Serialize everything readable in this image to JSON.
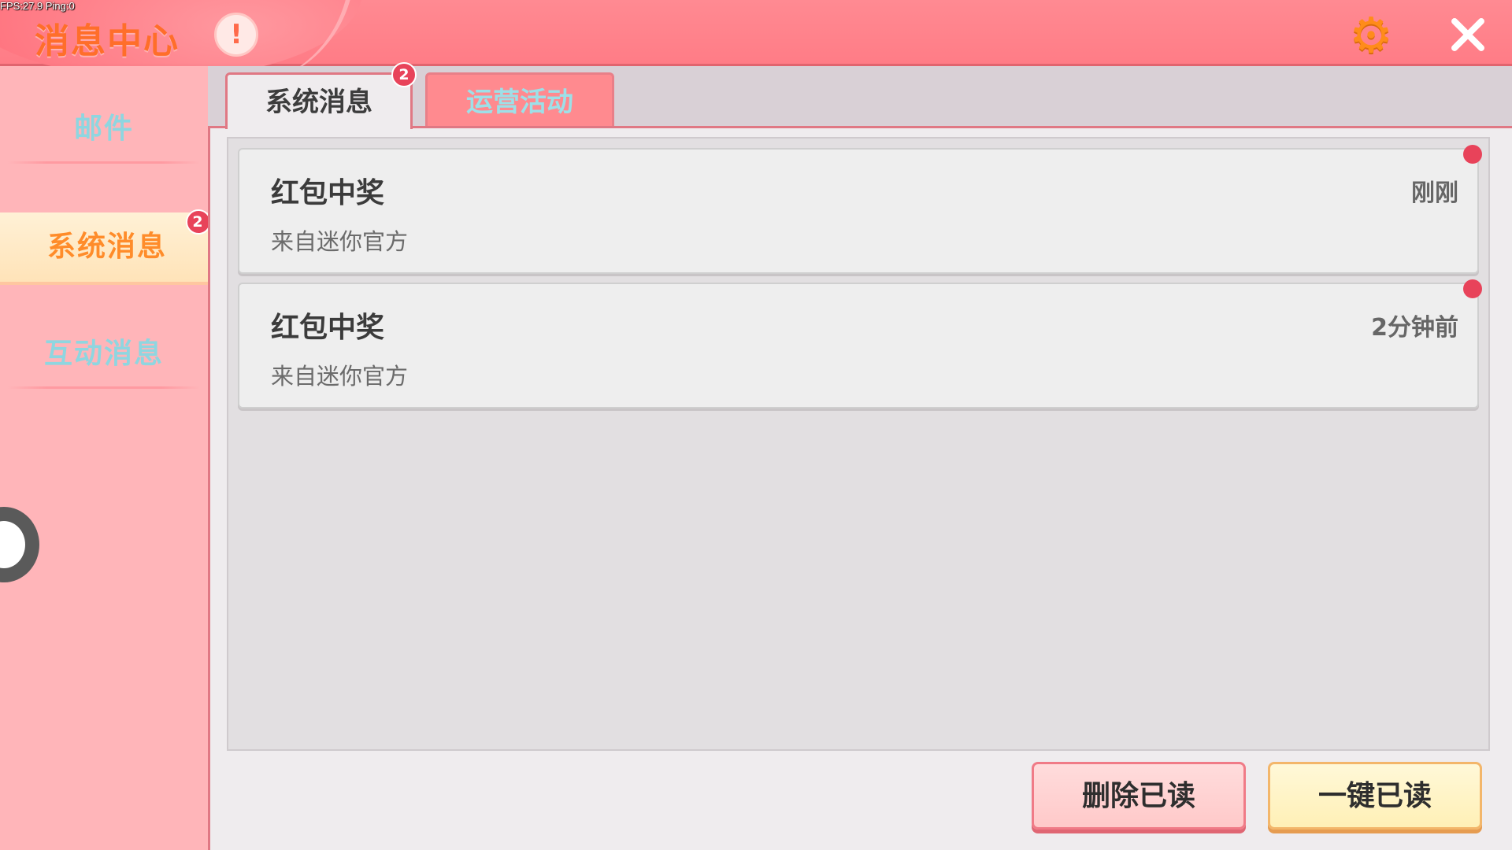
{
  "debug": {
    "fps_text": "FPS:27.9  Ping:0"
  },
  "header": {
    "title": "消息中心",
    "notice_icon": "exclamation-icon",
    "notice_glyph": "!",
    "settings_icon": "gear-icon",
    "settings_glyph": "⚙",
    "close_icon": "close-icon"
  },
  "sidebar": {
    "items": [
      {
        "label": "邮件",
        "active": false
      },
      {
        "label": "系统消息",
        "active": true,
        "badge": "2"
      },
      {
        "label": "互动消息",
        "active": false
      }
    ]
  },
  "tabs": [
    {
      "label": "系统消息",
      "active": true,
      "badge": "2"
    },
    {
      "label": "运营活动",
      "active": false
    }
  ],
  "messages": [
    {
      "title": "红包中奖",
      "source": "来自迷你官方",
      "time": "刚刚",
      "unread": true
    },
    {
      "title": "红包中奖",
      "source": "来自迷你官方",
      "time": "2分钟前",
      "unread": true
    }
  ],
  "actions": {
    "delete_read_label": "删除已读",
    "mark_all_read_label": "一键已读"
  },
  "colors": {
    "header_bg": "#ff7c86",
    "accent_orange": "#ff8c2a",
    "badge_red": "#e8435a",
    "inactive_text": "#8ed6e0"
  }
}
